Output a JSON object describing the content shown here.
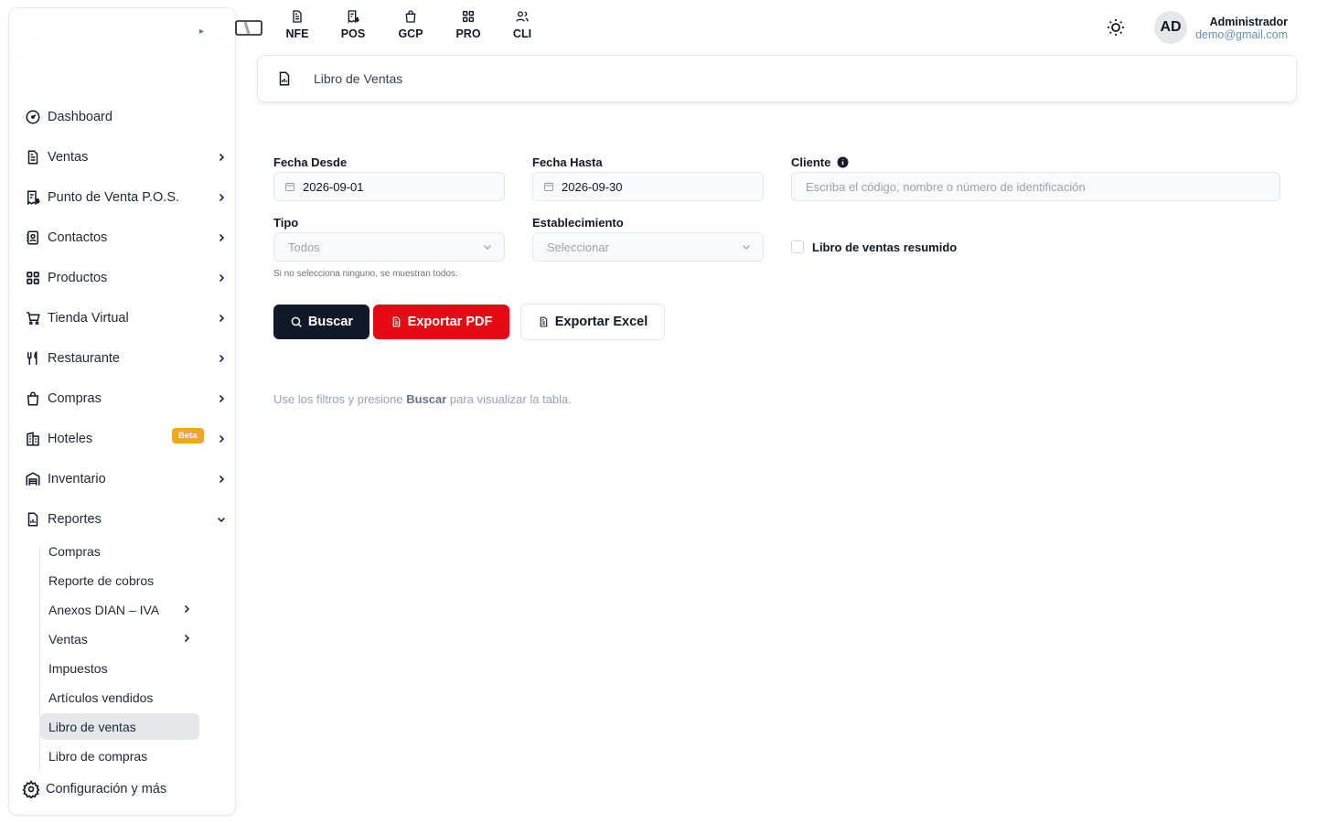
{
  "topbar": {
    "tabs": [
      {
        "label": "NFE",
        "icon": "invoice-icon"
      },
      {
        "label": "POS",
        "icon": "receipt-dollar-icon"
      },
      {
        "label": "GCP",
        "icon": "shopping-bag-icon"
      },
      {
        "label": "PRO",
        "icon": "grid-icon"
      },
      {
        "label": "CLI",
        "icon": "users-icon"
      }
    ],
    "user": {
      "initials": "AD",
      "name": "Administrador",
      "email": "demo@gmail.com"
    }
  },
  "sidebar": {
    "items": [
      {
        "label": "Dashboard",
        "icon": "gauge-icon"
      },
      {
        "label": "Ventas",
        "icon": "document-icon"
      },
      {
        "label": "Punto de Venta P.O.S.",
        "icon": "receipt-dollar-icon"
      },
      {
        "label": "Contactos",
        "icon": "contacts-icon"
      },
      {
        "label": "Productos",
        "icon": "grid-icon"
      },
      {
        "label": "Tienda Virtual",
        "icon": "cart-icon"
      },
      {
        "label": "Restaurante",
        "icon": "utensils-icon"
      },
      {
        "label": "Compras",
        "icon": "shopping-bag-icon"
      },
      {
        "label": "Hoteles",
        "icon": "building-icon",
        "badge": "Beta"
      },
      {
        "label": "Inventario",
        "icon": "warehouse-icon"
      },
      {
        "label": "Reportes",
        "icon": "report-icon"
      }
    ],
    "reportes_sub": [
      {
        "label": "Compras"
      },
      {
        "label": "Reporte de cobros"
      },
      {
        "label": "Anexos DIAN – IVA"
      },
      {
        "label": "Ventas"
      },
      {
        "label": "Impuestos"
      },
      {
        "label": "Artículos vendidos"
      },
      {
        "label": "Libro de ventas"
      },
      {
        "label": "Libro de compras"
      }
    ],
    "config": {
      "label": "Configuración y más",
      "icon": "gear-icon"
    }
  },
  "breadcrumb": {
    "title": "Libro de Ventas"
  },
  "form": {
    "fecha_desde": {
      "label": "Fecha Desde",
      "value": "2026-09-01"
    },
    "fecha_hasta": {
      "label": "Fecha Hasta",
      "value": "2026-09-30"
    },
    "cliente": {
      "label": "Cliente",
      "placeholder": "Escriba el código, nombre o número de identificación"
    },
    "tipo": {
      "label": "Tipo",
      "value": "Todos",
      "help": "Si no selecciona ninguno, se muestran todos."
    },
    "establecimiento": {
      "label": "Establecimiento",
      "value": "Seleccionar"
    },
    "resumido": {
      "label": "Libro de ventas resumido",
      "checked": false
    }
  },
  "actions": {
    "buscar": "Buscar",
    "exportar_pdf": "Exportar PDF",
    "exportar_excel": "Exportar Excel"
  },
  "hint": {
    "prefix": "Use los filtros y presione ",
    "bold": "Buscar",
    "suffix": " para visualizar la tabla."
  },
  "colors": {
    "primary_button": "#111827",
    "pdf_button": "#e50914",
    "beta_badge": "#f5a524",
    "active_item": "#e5e7eb"
  }
}
